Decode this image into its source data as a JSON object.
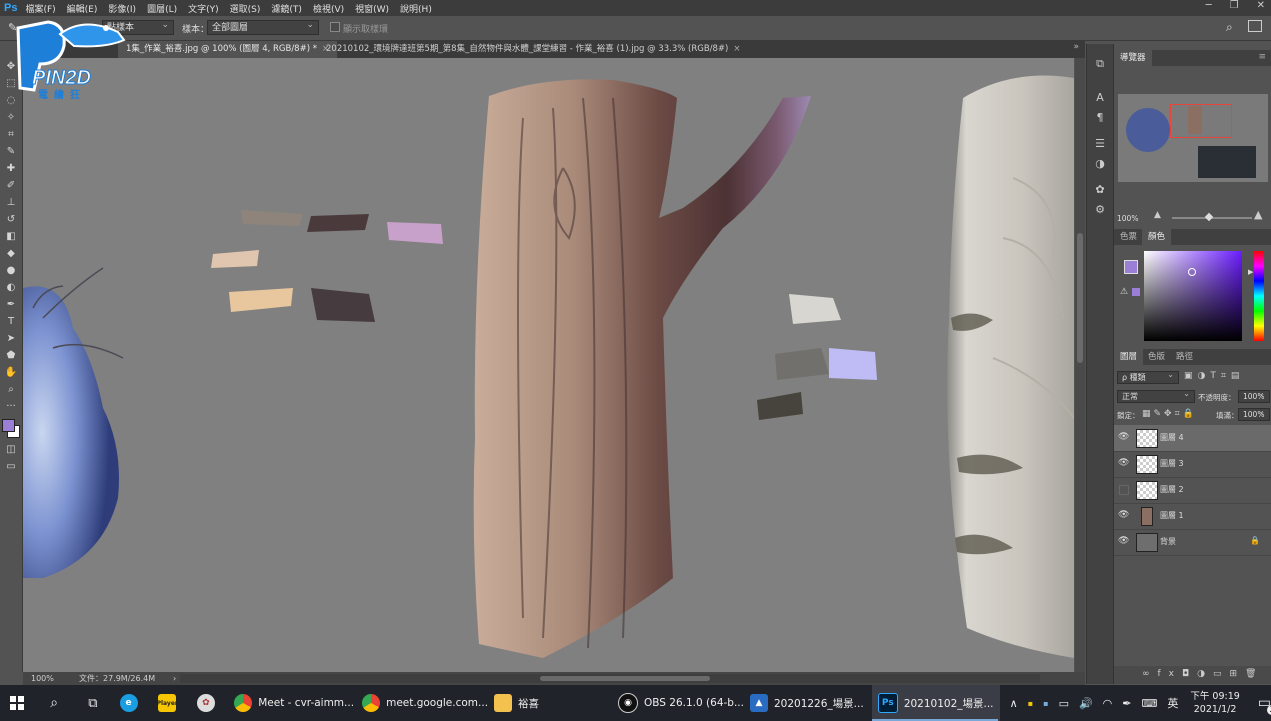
{
  "app": {
    "logo": "Ps"
  },
  "menu": [
    "檔案(F)",
    "編輯(E)",
    "影像(I)",
    "圖層(L)",
    "文字(Y)",
    "選取(S)",
    "濾鏡(T)",
    "檢視(V)",
    "視窗(W)",
    "說明(H)"
  ],
  "window_controls": {
    "minimize": "─",
    "restore": "❐",
    "close": "✕"
  },
  "options_bar": {
    "sample_size_value": "點樣本",
    "sample_label": "樣本：",
    "sample_value": "全部圖層",
    "show_ring_label": "顯示取樣環"
  },
  "watermark": {
    "brand": "PIN2D",
    "subtitle": "電繪狂"
  },
  "tabs": [
    {
      "label": "1集_作業_裕喜.jpg @ 100% (圖層 4, RGB/8#) *",
      "close": "×",
      "active": true
    },
    {
      "label": "20210102_環境牌達班第5期_第8集_自然物件與水體_課堂練習 - 作業_裕喜 (1).jpg @ 33.3% (RGB/8#)",
      "close": "×",
      "active": false
    }
  ],
  "status": {
    "zoom": "100%",
    "doc": "文件：27.9M/26.4M",
    "arrow": "›"
  },
  "navigator": {
    "title": "導覽器",
    "zoom": "100%"
  },
  "color_panel": {
    "tabs": [
      "色票",
      "顏色"
    ],
    "active_tab": "顏色",
    "foreground": "#9b7fd6",
    "background": "#ffffff"
  },
  "layers_panel": {
    "tabs": [
      "圖層",
      "色版",
      "路徑"
    ],
    "active_tab": "圖層",
    "filter_label": "ρ 種類",
    "blend_mode": "正常",
    "opacity_label": "不透明度：",
    "opacity_value": "100%",
    "lock_label": "鎖定：",
    "fill_label": "填滿：",
    "fill_value": "100%",
    "layers": [
      {
        "name": "圖層 4",
        "visible": true,
        "selected": true
      },
      {
        "name": "圖層 3",
        "visible": true,
        "selected": false
      },
      {
        "name": "圖層 2",
        "visible": false,
        "selected": false
      },
      {
        "name": "圖層 1",
        "visible": true,
        "selected": false
      },
      {
        "name": "背景",
        "visible": true,
        "selected": false,
        "locked": true
      }
    ]
  },
  "taskbar": {
    "items": [
      {
        "label": "Meet - cvr-aimm...",
        "icon": "chrome-icon"
      },
      {
        "label": "meet.google.com...",
        "icon": "chrome-icon"
      },
      {
        "label": "裕喜",
        "icon": "folder-icon"
      },
      {
        "label": "OBS 26.1.0 (64-b...",
        "icon": "obs-icon"
      },
      {
        "label": "20201226_場景...",
        "icon": "photos-icon"
      },
      {
        "label": "20210102_場景...",
        "icon": "photoshop-icon"
      }
    ],
    "tray_text": "英",
    "time": "下午 09:19",
    "date": "2021/1/2",
    "notifications": "2",
    "ps_icon_text": "Ps",
    "note_icon_text": "Player"
  }
}
